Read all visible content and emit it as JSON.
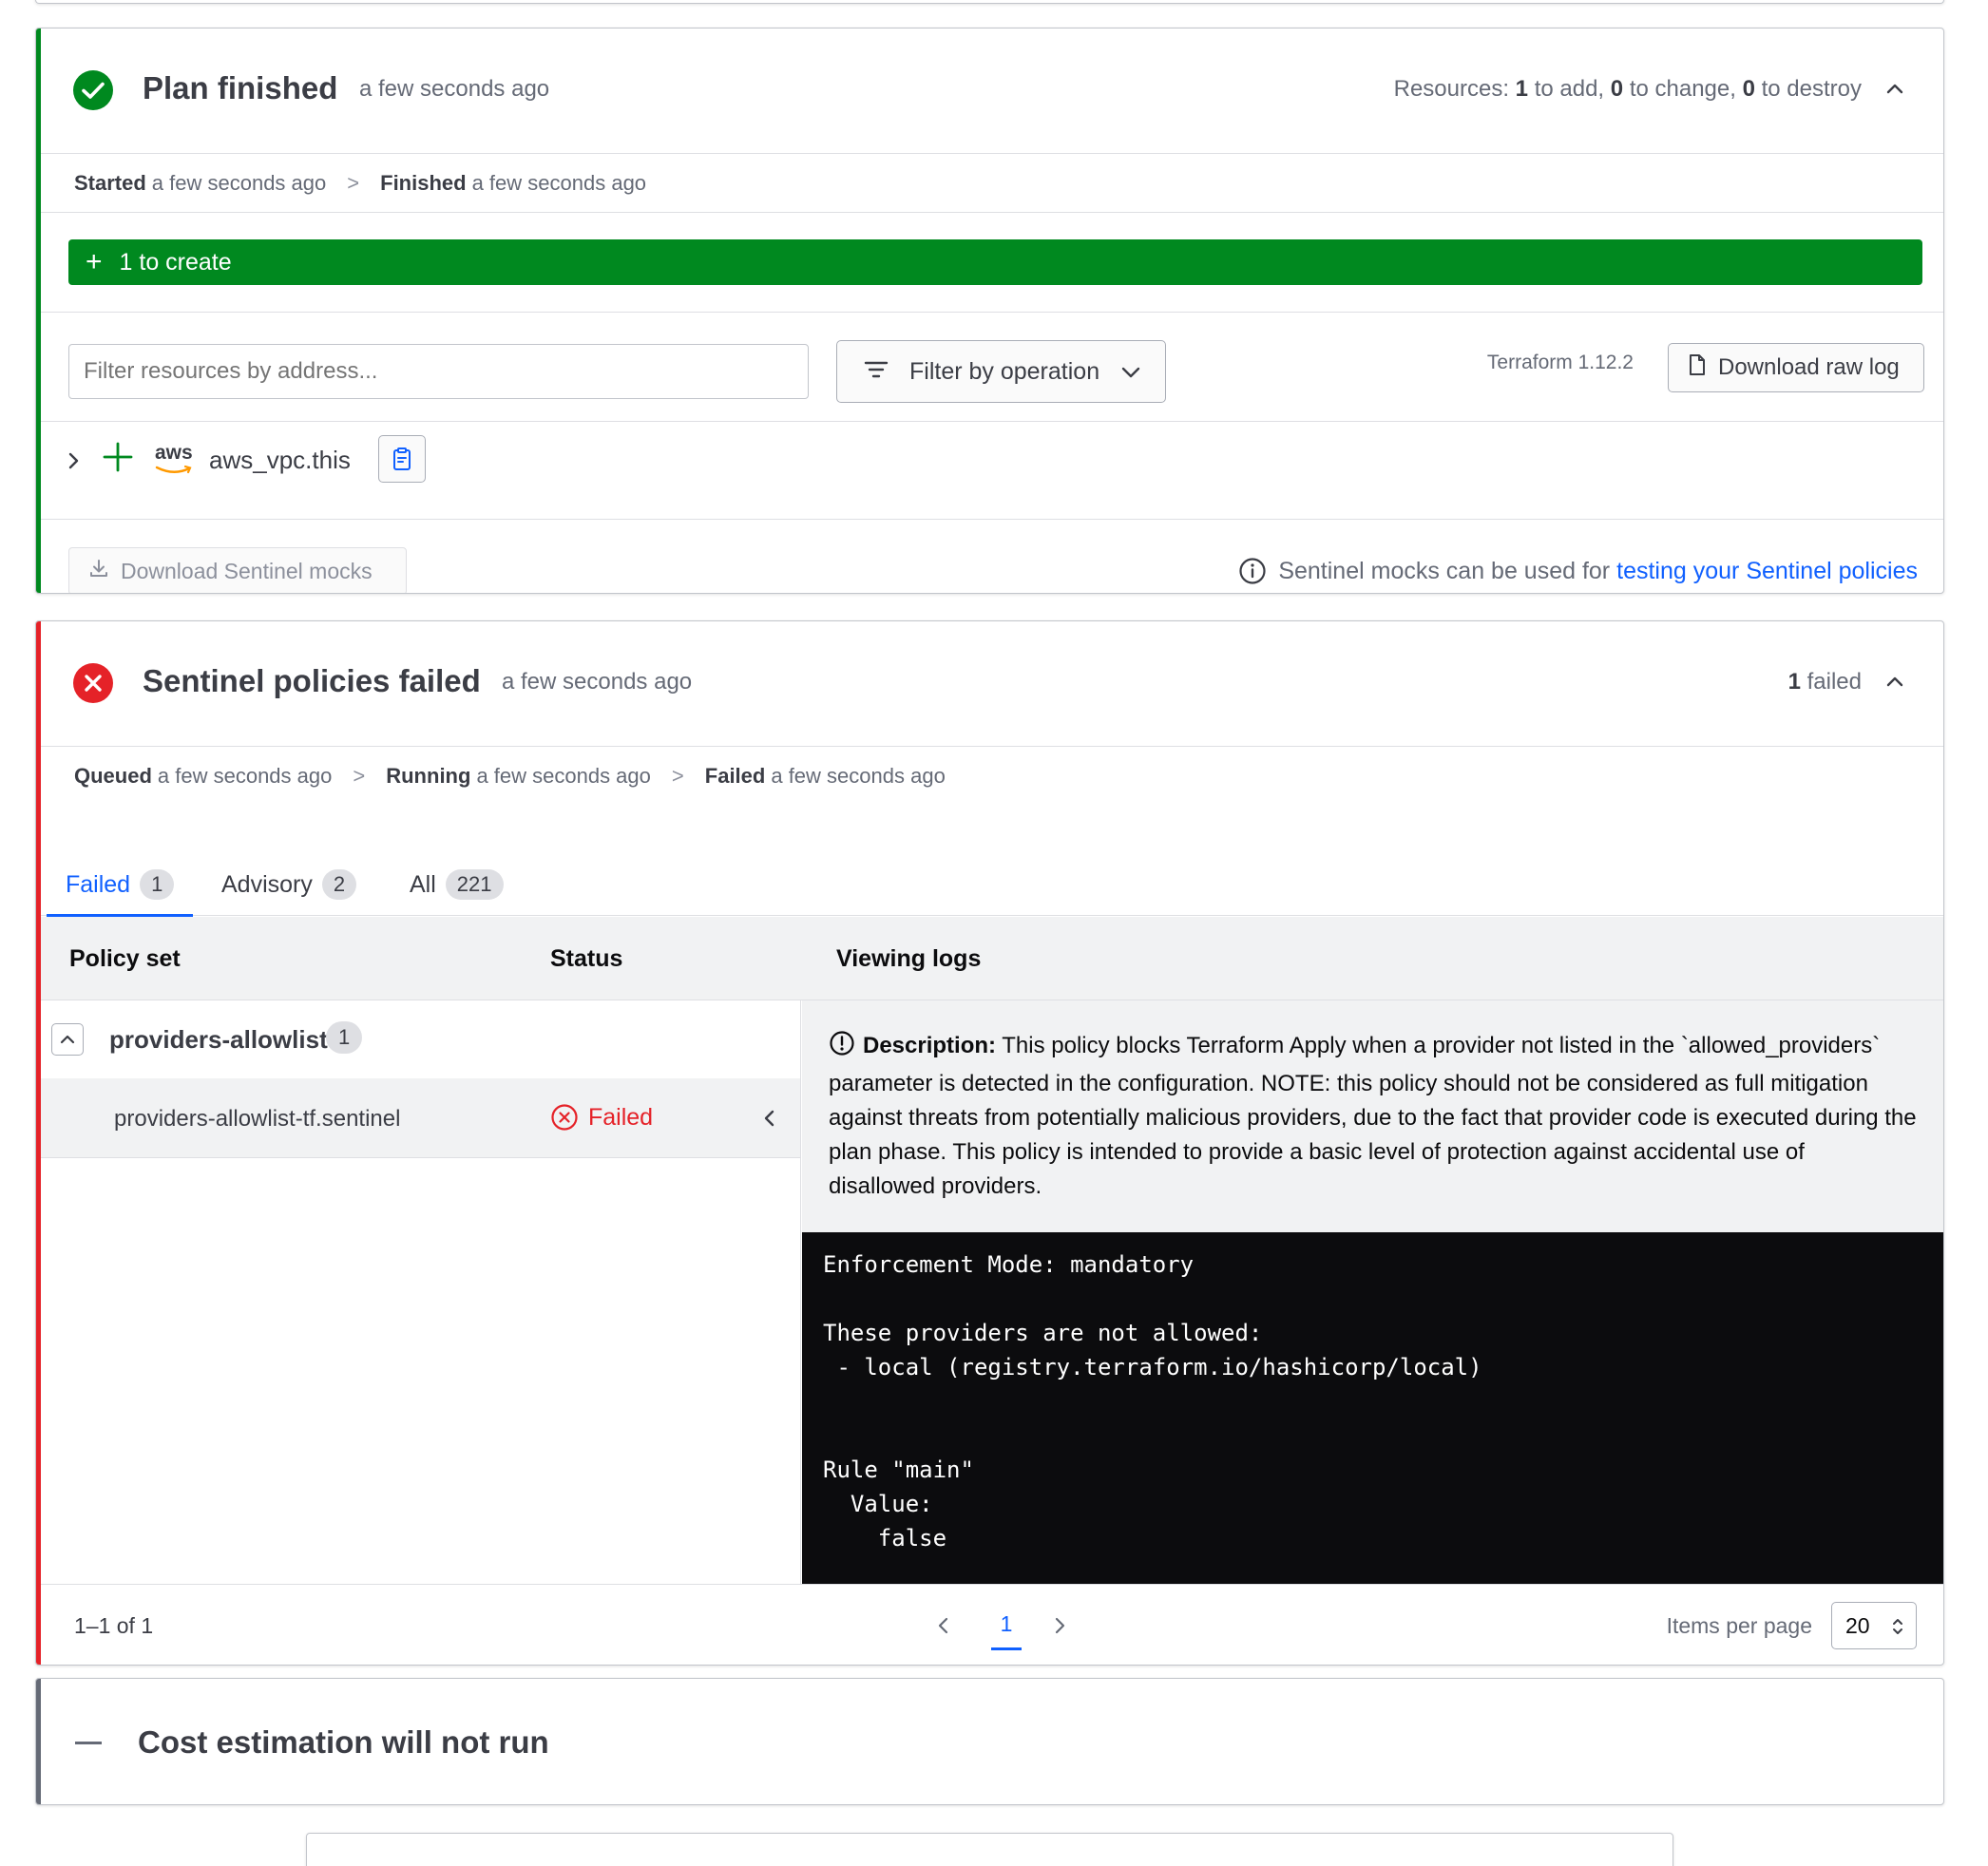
{
  "plan": {
    "title": "Plan finished",
    "time": "a few seconds ago",
    "resources_prefix": "Resources:",
    "resources_add": "1",
    "resources_add_label": "to add,",
    "resources_change": "0",
    "resources_change_label": "to change,",
    "resources_destroy": "0",
    "resources_destroy_label": "to destroy",
    "timeline": {
      "started_label": "Started",
      "started_time": "a few seconds ago",
      "finished_label": "Finished",
      "finished_time": "a few seconds ago",
      "separator": ">"
    },
    "create_bar_label": "1 to create",
    "filter_placeholder": "Filter resources by address...",
    "filter_by_operation": "Filter by operation",
    "terraform_version": "Terraform 1.12.2",
    "download_raw_log": "Download raw log",
    "resource": {
      "provider_logo_text": "aws",
      "name": "aws_vpc.this"
    },
    "download_mocks": "Download Sentinel mocks",
    "mocks_info_text": "Sentinel mocks can be used for",
    "mocks_info_link": "testing your Sentinel policies"
  },
  "policies": {
    "title": "Sentinel policies failed",
    "time": "a few seconds ago",
    "failed_count": "1",
    "failed_label": "failed",
    "timeline": {
      "queued_label": "Queued",
      "queued_time": "a few seconds ago",
      "running_label": "Running",
      "running_time": "a few seconds ago",
      "failed_label": "Failed",
      "failed_time": "a few seconds ago",
      "separator": ">"
    },
    "tabs": [
      {
        "label": "Failed",
        "count": "1"
      },
      {
        "label": "Advisory",
        "count": "2"
      },
      {
        "label": "All",
        "count": "221"
      }
    ],
    "columns": {
      "policy_set": "Policy set",
      "status": "Status",
      "viewing_logs": "Viewing logs"
    },
    "policy_set": {
      "name": "providers-allowlist",
      "count": "1"
    },
    "policy": {
      "name": "providers-allowlist-tf.sentinel",
      "status": "Failed"
    },
    "description_label": "Description:",
    "description_text": "This policy blocks Terraform Apply when a provider not listed in the `allowed_providers` parameter is detected in the configuration. NOTE: this policy should not be considered as full mitigation against threats from potentially malicious providers, due to the fact that provider code is executed during the plan phase. This policy is intended to provide a basic level of protection against accidental use of disallowed providers.",
    "log_text": "Enforcement Mode: mandatory\n\nThese providers are not allowed:\n - local (registry.terraform.io/hashicorp/local)\n\n\nRule \"main\"\n  Value:\n    false",
    "pagination": {
      "range": "1–1 of 1",
      "current_page": "1",
      "items_per_page_label": "Items per page",
      "items_per_page": "20"
    }
  },
  "cost": {
    "title": "Cost estimation will not run"
  },
  "colors": {
    "success": "#00891f",
    "critical": "#e52228",
    "neutral_accent": "#656a76",
    "link": "#1060ff"
  }
}
